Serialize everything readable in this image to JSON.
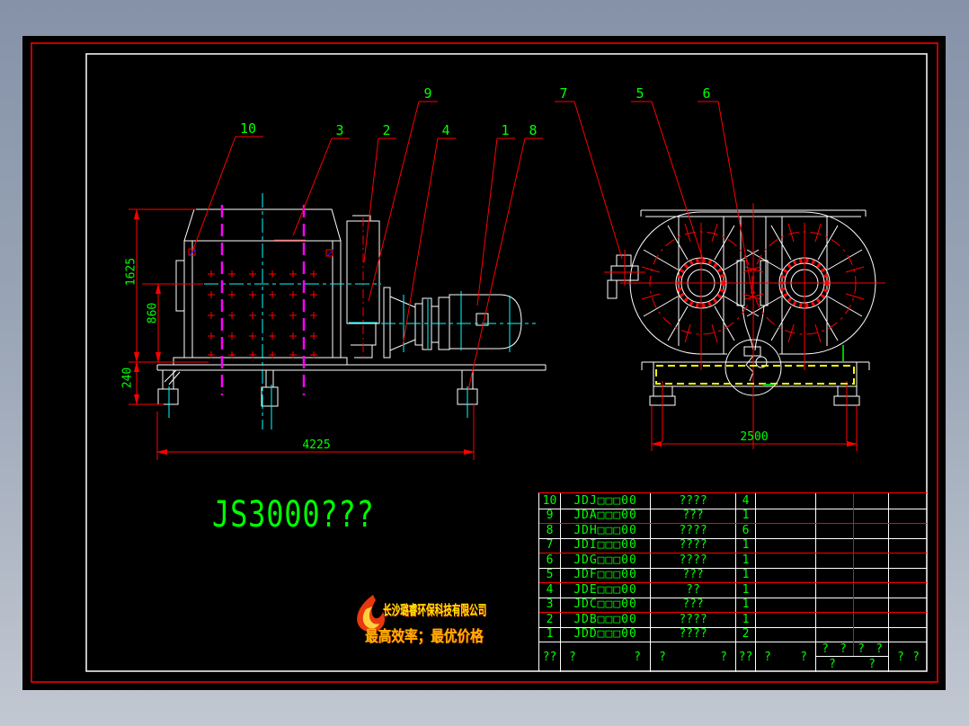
{
  "callouts": [
    {
      "label": "10"
    },
    {
      "label": "3"
    },
    {
      "label": "2"
    },
    {
      "label": "9"
    },
    {
      "label": "4"
    },
    {
      "label": "1"
    },
    {
      "label": "8"
    },
    {
      "label": "7"
    },
    {
      "label": "5"
    },
    {
      "label": "6"
    }
  ],
  "dimensions": {
    "total_height": "1625",
    "axis_height": "860",
    "base_height": "240",
    "front_width": "4225",
    "side_width": "2500"
  },
  "drawing_title": "JS3000???",
  "logo": {
    "icon": "flame-icon",
    "company": "长沙璐睿环保科技有限公司",
    "slogan": "最高效率；最优价格"
  },
  "parts_table": {
    "rows": [
      {
        "no": "10",
        "code": "JDJ□□□00",
        "name": "????",
        "qty": "4"
      },
      {
        "no": "9",
        "code": "JDA□□□00",
        "name": "???",
        "qty": "1"
      },
      {
        "no": "8",
        "code": "JDH□□□00",
        "name": "????",
        "qty": "6"
      },
      {
        "no": "7",
        "code": "JDI□□□00",
        "name": "????",
        "qty": "1"
      },
      {
        "no": "6",
        "code": "JDG□□□00",
        "name": "????",
        "qty": "1"
      },
      {
        "no": "5",
        "code": "JDF□□□00",
        "name": "???",
        "qty": "1"
      },
      {
        "no": "4",
        "code": "JDE□□□00",
        "name": "??",
        "qty": "1"
      },
      {
        "no": "3",
        "code": "JDC□□□00",
        "name": "???",
        "qty": "1"
      },
      {
        "no": "2",
        "code": "JDB□□□00",
        "name": "????",
        "qty": "1"
      },
      {
        "no": "1",
        "code": "JDD□□□00",
        "name": "????",
        "qty": "2"
      }
    ],
    "footer": {
      "c1": "??",
      "c2_left": "?",
      "c2_right": "?",
      "c3_left": "?",
      "c3_right": "?",
      "c4": "??",
      "c5_left": "?",
      "c5_right": "?",
      "c6_top": [
        "?",
        "?",
        "?",
        "?"
      ],
      "c6_bottom": [
        "?",
        "?"
      ],
      "c7_left": "?",
      "c7_right": "?"
    }
  },
  "colors": {
    "geometry": "#ffffff",
    "annotation": "#ff0000",
    "text": "#00ff00",
    "centerline": "#00ffff",
    "phantom": "#ff00ff",
    "base_dashed": "#ffff00"
  }
}
